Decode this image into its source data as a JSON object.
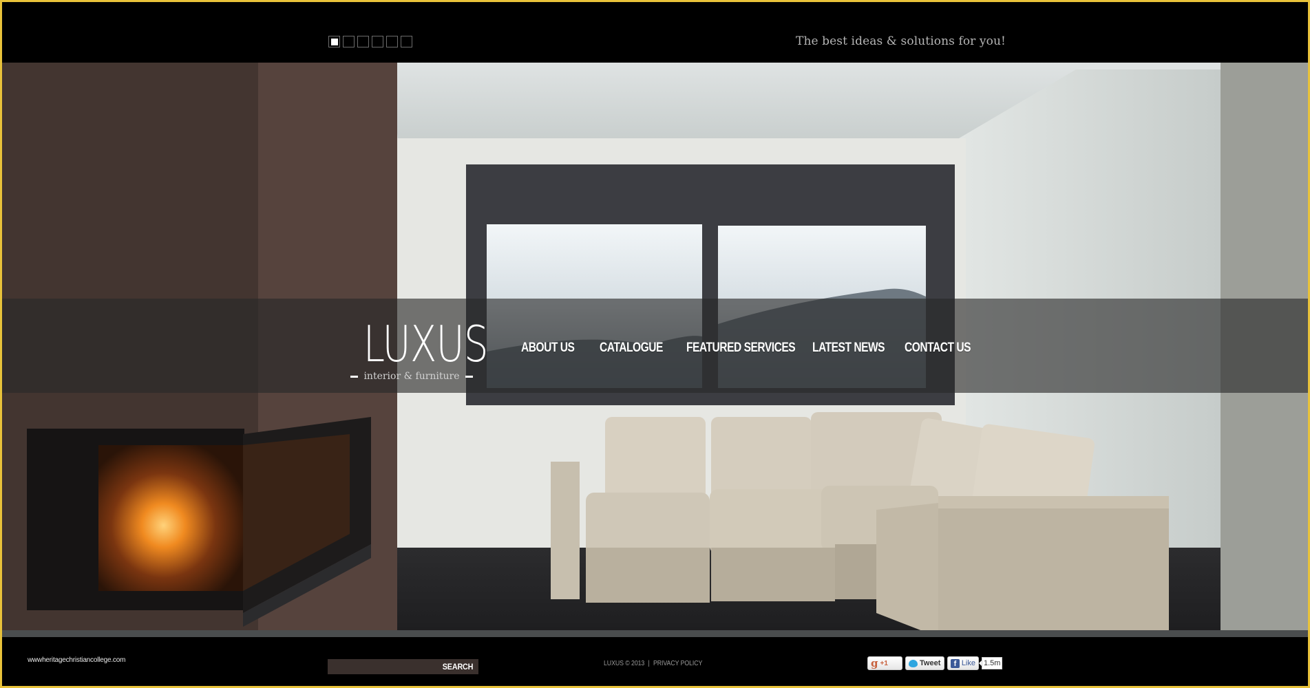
{
  "top_bar": {
    "slider_pager": {
      "count": 6,
      "active_index": 0
    },
    "tagline": "The best ideas & solutions for you!"
  },
  "brand": {
    "logo": "LUXUS",
    "subtitle": "interior & furniture"
  },
  "nav": {
    "items": [
      {
        "label": "ABOUT US"
      },
      {
        "label": "CATALOGUE"
      },
      {
        "label": "FEATURED SERVICES"
      },
      {
        "label": "LATEST NEWS"
      },
      {
        "label": "CONTACT US"
      }
    ]
  },
  "hero": {
    "image_description": "Modern living room with corner fireplace, large window overlooking mountains, and beige sectional sofa"
  },
  "footer": {
    "site_url": "wwwheritagechristiancollege.com",
    "search": {
      "value": "",
      "placeholder": "",
      "button_label": "SEARCH"
    },
    "copyright": "LUXUS © 2013",
    "separator": "|",
    "privacy_link": "PRIVACY POLICY",
    "social": {
      "gplus_label": "+1",
      "gplus_icon": "g",
      "tweet_label": "Tweet",
      "like_label": "Like",
      "like_icon": "f",
      "like_count": "1.5m"
    }
  },
  "colors": {
    "frame_border": "#e8c23a",
    "background": "#000000",
    "nav_text": "#ffffff",
    "tagline_text": "#b5b5b5",
    "search_bg": "#3a302d"
  }
}
